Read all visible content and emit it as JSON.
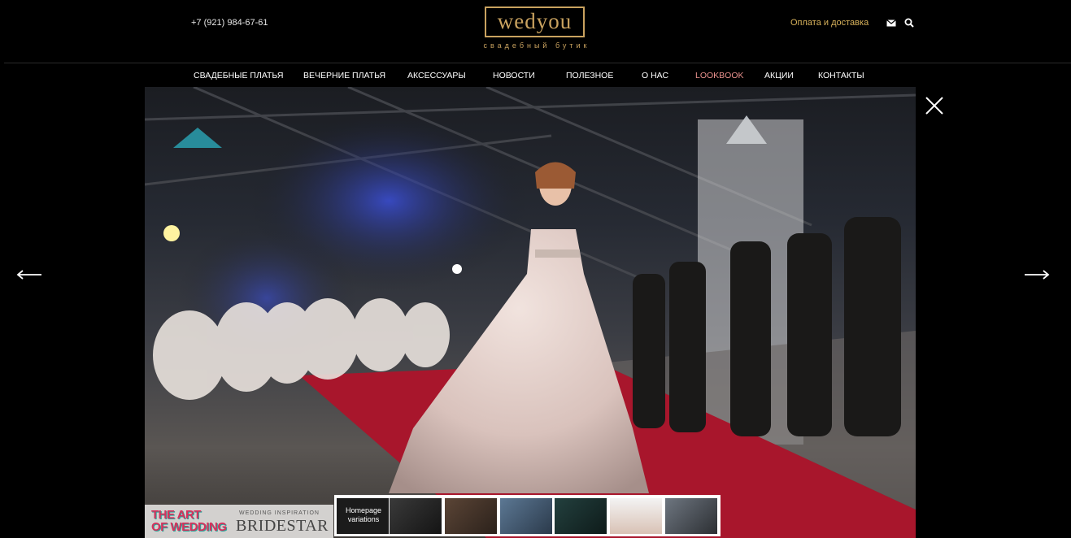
{
  "header": {
    "phone": "+7 (921) 984-67-61",
    "logo_text": "wedyou",
    "logo_tagline": "свадебный бутик",
    "delivery_link": "Оплата и доставка"
  },
  "nav": {
    "items": [
      {
        "label": "СВАДЕБНЫЕ ПЛАТЬЯ"
      },
      {
        "label": "ВЕЧЕРНИЕ ПЛАТЬЯ"
      },
      {
        "label": "АКСЕССУАРЫ"
      },
      {
        "label": "НОВОСТИ"
      },
      {
        "label": "ПОЛЕЗНОЕ"
      },
      {
        "label": "О НАС"
      },
      {
        "label": "LOOKBOOK"
      },
      {
        "label": "АКЦИИ"
      },
      {
        "label": "КОНТАКТЫ"
      }
    ],
    "active_color": "#e8908c"
  },
  "banner": {
    "left_line1": "THE ART",
    "left_line2": "OF WEDDING",
    "small": "WEDDING INSPIRATION",
    "right": "BRIDESTAR"
  },
  "thumbnail_strip": {
    "first_label_line1": "Homepage",
    "first_label_line2": "variations"
  },
  "colors": {
    "background": "#000000",
    "accent_gold": "#c9a25f",
    "delivery_text": "#d9b35c"
  },
  "icons": [
    "mail-icon",
    "search-icon",
    "close-icon",
    "arrow-left-icon",
    "arrow-right-icon"
  ]
}
